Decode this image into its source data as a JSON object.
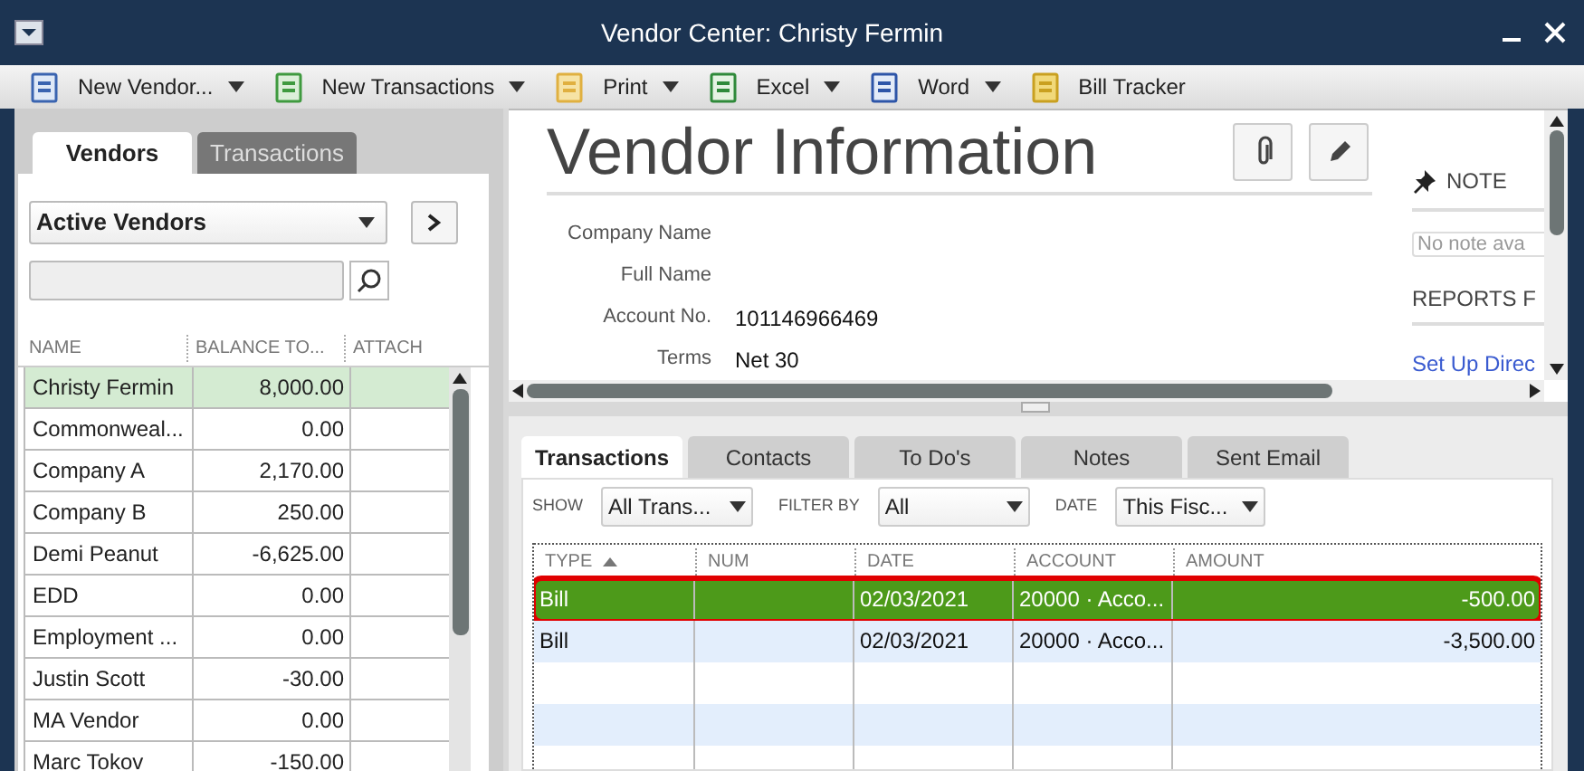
{
  "window": {
    "title": "Vendor Center: Christy Fermin"
  },
  "toolbar": [
    {
      "label": "New Vendor...",
      "kind": "menu"
    },
    {
      "label": "New Transactions",
      "kind": "menu"
    },
    {
      "label": "Print",
      "kind": "menu"
    },
    {
      "label": "Excel",
      "kind": "menu"
    },
    {
      "label": "Word",
      "kind": "menu"
    },
    {
      "label": "Bill Tracker",
      "kind": "button"
    }
  ],
  "left_tabs": [
    {
      "label": "Vendors",
      "selected": true
    },
    {
      "label": "Transactions",
      "selected": false
    }
  ],
  "vendor_filter": {
    "value": "Active Vendors"
  },
  "vendor_table": {
    "columns": [
      "NAME",
      "BALANCE TO...",
      "ATTACH"
    ],
    "rows": [
      {
        "name": "Christy Fermin",
        "balance": "8,000.00",
        "selected": true
      },
      {
        "name": "Commonweal...",
        "balance": "0.00",
        "selected": false
      },
      {
        "name": "Company A",
        "balance": "2,170.00",
        "selected": false
      },
      {
        "name": "Company B",
        "balance": "250.00",
        "selected": false
      },
      {
        "name": "Demi Peanut",
        "balance": "-6,625.00",
        "selected": false
      },
      {
        "name": "EDD",
        "balance": "0.00",
        "selected": false
      },
      {
        "name": "Employment ...",
        "balance": "0.00",
        "selected": false
      },
      {
        "name": "Justin Scott",
        "balance": "-30.00",
        "selected": false
      },
      {
        "name": "MA Vendor",
        "balance": "0.00",
        "selected": false
      },
      {
        "name": "Marc Tokov",
        "balance": "-150.00",
        "selected": false
      }
    ]
  },
  "vendor_info": {
    "title": "Vendor Information",
    "fields": [
      {
        "label": "Company Name"
      },
      {
        "label": "Full Name"
      },
      {
        "label": "Account No.",
        "value": "101146966469"
      },
      {
        "label": "Terms",
        "value": "Net 30"
      }
    ],
    "note": {
      "heading": "NOTE",
      "placeholder": "No note ava"
    },
    "reports_heading": "REPORTS F",
    "link": "Set Up Direc"
  },
  "detail_tabs": [
    {
      "label": "Transactions",
      "selected": true
    },
    {
      "label": "Contacts",
      "selected": false
    },
    {
      "label": "To Do's",
      "selected": false
    },
    {
      "label": "Notes",
      "selected": false
    },
    {
      "label": "Sent Email",
      "selected": false
    }
  ],
  "filters": [
    {
      "label": "SHOW",
      "value": "All Trans..."
    },
    {
      "label": "FILTER BY",
      "value": "All"
    },
    {
      "label": "DATE",
      "value": "This Fisc..."
    }
  ],
  "transactions": {
    "columns": [
      "TYPE",
      "NUM",
      "DATE",
      "ACCOUNT",
      "AMOUNT"
    ],
    "rows": [
      {
        "cells": [
          "Bill",
          "",
          "02/03/2021",
          "20000 · Acco...",
          "-500.00"
        ],
        "selected": true
      },
      {
        "cells": [
          "Bill",
          "",
          "02/03/2021",
          "20000 · Acco...",
          "-3,500.00"
        ],
        "selected": false
      }
    ]
  }
}
